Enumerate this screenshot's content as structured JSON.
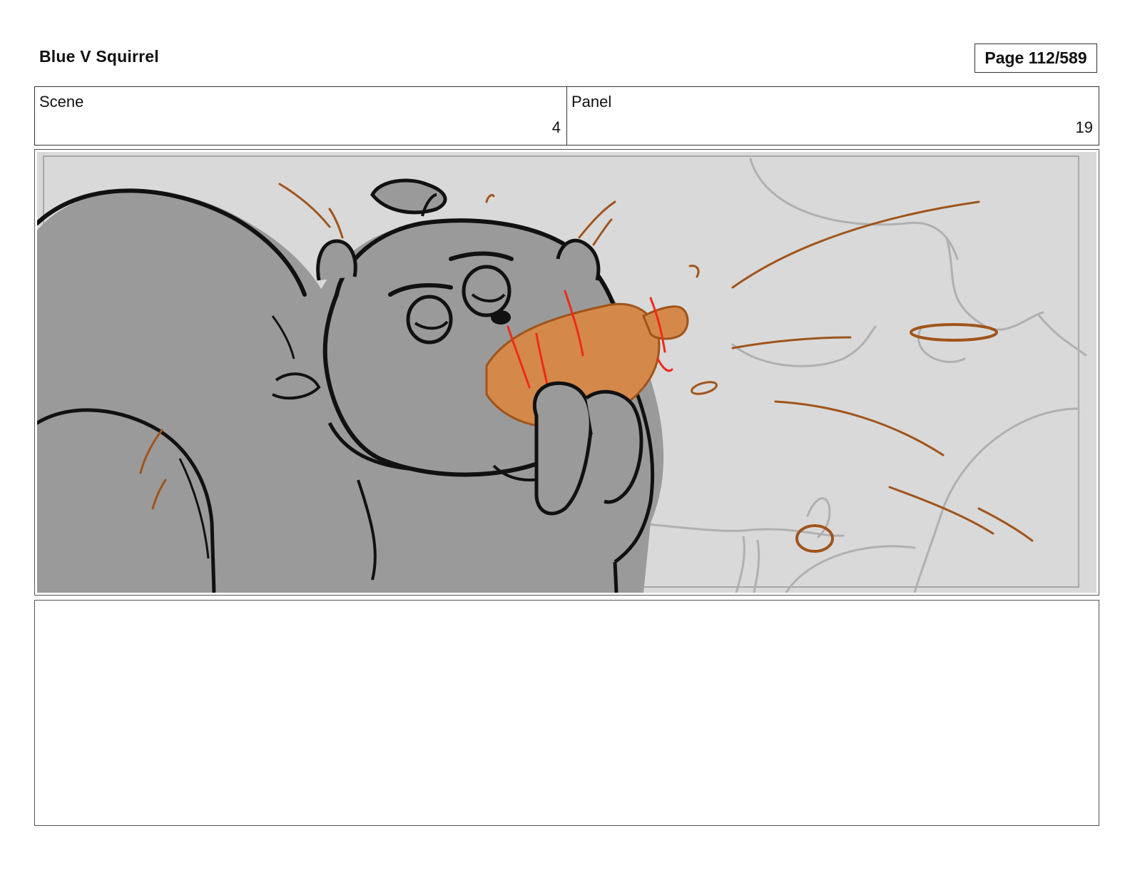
{
  "document": {
    "title": "Blue V Squirrel",
    "page_label": "Page 112/589"
  },
  "info": {
    "scene_label": "Scene",
    "scene_value": "4",
    "panel_label": "Panel",
    "panel_value": "19"
  },
  "artwork": {
    "subject": "squirrel-biting-acorn-sketch",
    "colors": {
      "background": "#d9d9d9",
      "squirrel_fill": "#9a9a9a",
      "acorn_fill": "#d4884a",
      "motion_lines": "#a0541a",
      "accent_red": "#ee2a1a"
    }
  },
  "notes": {
    "text": ""
  }
}
